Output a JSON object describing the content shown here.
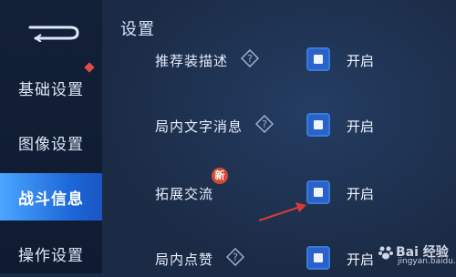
{
  "sidebar": {
    "items": [
      {
        "label": "基础设置"
      },
      {
        "label": "图像设置"
      },
      {
        "label": "战斗信息"
      },
      {
        "label": "操作设置"
      }
    ]
  },
  "header": {
    "title": "设置"
  },
  "settings": [
    {
      "label": "推荐装描述",
      "status": "开启"
    },
    {
      "label": "局内文字消息",
      "status": "开启"
    },
    {
      "label": "拓展交流",
      "status": "开启",
      "badge": "新"
    },
    {
      "label": "局内点赞",
      "status": "开启"
    }
  ],
  "watermark": {
    "text": "Bai 经验",
    "sub": "jingyan.baidu.com"
  }
}
